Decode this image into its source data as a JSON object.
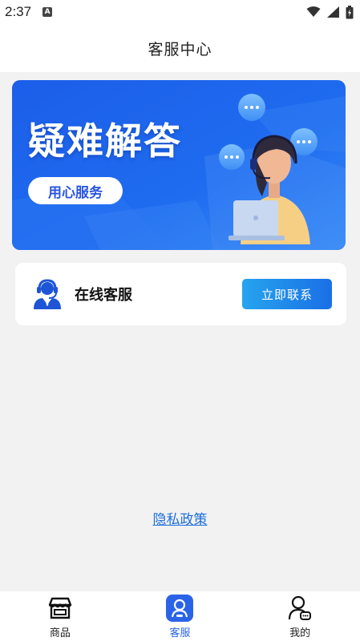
{
  "status_bar": {
    "time": "2:37",
    "notification_letter": "A"
  },
  "header": {
    "title": "客服中心"
  },
  "banner": {
    "title": "疑难解答",
    "pill": "用心服务"
  },
  "service": {
    "label": "在线客服",
    "button": "立即联系"
  },
  "privacy_link": "隐私政策",
  "tabs": [
    {
      "label": "商品",
      "icon": "shop-icon"
    },
    {
      "label": "客服",
      "icon": "customer-service-icon",
      "active": true
    },
    {
      "label": "我的",
      "icon": "user-icon"
    }
  ],
  "colors": {
    "accent": "#2a63e8",
    "button": "#1a8ee8",
    "link": "#1e6fd9",
    "banner": "#1f5be8"
  }
}
